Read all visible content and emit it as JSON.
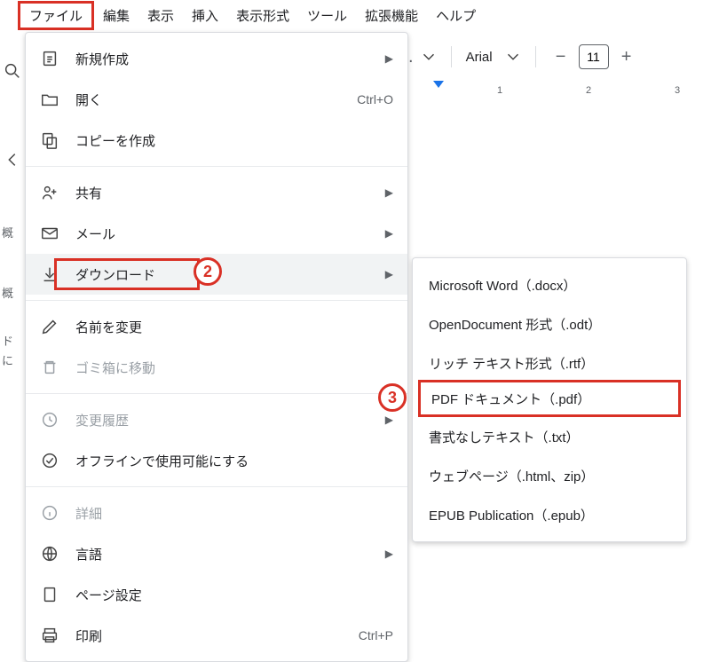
{
  "menubar": {
    "items": [
      "ファイル",
      "編集",
      "表示",
      "挿入",
      "表示形式",
      "ツール",
      "拡張機能",
      "ヘルプ"
    ]
  },
  "toolbar": {
    "font": "Arial",
    "size": "11"
  },
  "ruler": {
    "marks": [
      "1",
      "2",
      "3"
    ]
  },
  "fileMenu": {
    "newDoc": "新規作成",
    "open": "開く",
    "openShortcut": "Ctrl+O",
    "makeCopy": "コピーを作成",
    "share": "共有",
    "email": "メール",
    "download": "ダウンロード",
    "rename": "名前を変更",
    "moveToTrash": "ゴミ箱に移動",
    "versionHistory": "変更履歴",
    "offlineAvailable": "オフラインで使用可能にする",
    "details": "詳細",
    "language": "言語",
    "pageSetup": "ページ設定",
    "print": "印刷",
    "printShortcut": "Ctrl+P"
  },
  "downloadSubmenu": {
    "docx": "Microsoft Word（.docx）",
    "odt": "OpenDocument 形式（.odt）",
    "rtf": "リッチ テキスト形式（.rtf）",
    "pdf": "PDF ドキュメント（.pdf）",
    "txt": "書式なしテキスト（.txt）",
    "html": "ウェブページ（.html、zip）",
    "epub": "EPUB Publication（.epub）"
  },
  "callouts": {
    "two": "2",
    "three": "3"
  },
  "sidebar": {
    "outline": "概",
    "outline2": "概",
    "doc": "ド",
    "ni": "に"
  }
}
